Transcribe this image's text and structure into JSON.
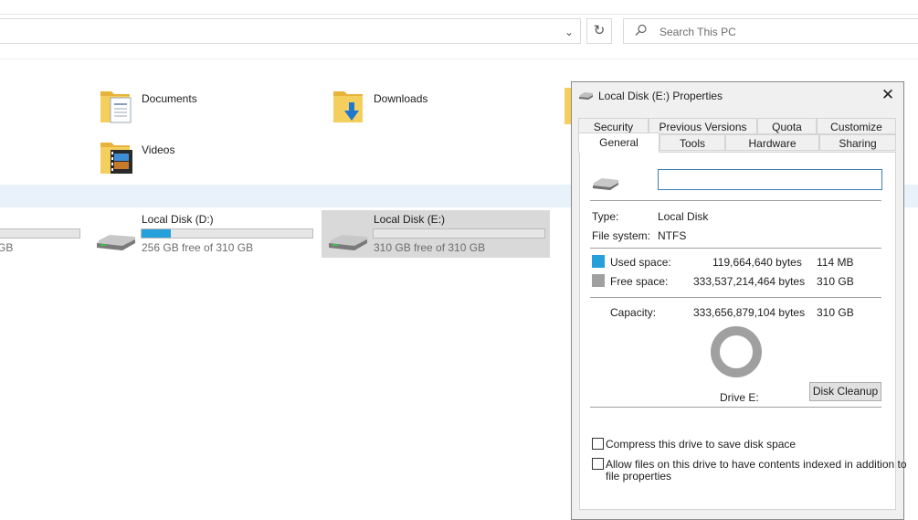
{
  "explorer": {
    "search_placeholder": "Search This PC",
    "folders": [
      {
        "label": "Documents"
      },
      {
        "label": "Downloads"
      },
      {
        "label": "Videos"
      }
    ],
    "drives": [
      {
        "name": "",
        "free_text": "GB",
        "used_fraction": 0.0
      },
      {
        "name": "Local Disk (D:)",
        "free_text": "256 GB free of 310 GB",
        "used_fraction": 0.17
      },
      {
        "name": "Local Disk (E:)",
        "free_text": "310 GB free of 310 GB",
        "used_fraction": 0.0
      }
    ]
  },
  "dialog": {
    "title": "Local Disk (E:) Properties",
    "tabs_row1": [
      "Security",
      "Previous Versions",
      "Quota",
      "Customize"
    ],
    "tabs_row2": [
      "General",
      "Tools",
      "Hardware",
      "Sharing"
    ],
    "active_tab": "General",
    "name_value": "",
    "type_label": "Type:",
    "type_value": "Local Disk",
    "fs_label": "File system:",
    "fs_value": "NTFS",
    "used_label": "Used space:",
    "used_bytes": "119,664,640 bytes",
    "used_size": "114 MB",
    "free_label": "Free space:",
    "free_bytes": "333,537,214,464 bytes",
    "free_size": "310 GB",
    "capacity_label": "Capacity:",
    "capacity_bytes": "333,656,879,104 bytes",
    "capacity_size": "310 GB",
    "drive_label": "Drive E:",
    "cleanup_label": "Disk Cleanup",
    "compress_label": "Compress this drive to save disk space",
    "index_label_line1": "Allow files on this drive to have contents indexed in addition to",
    "index_label_line2": "file properties",
    "colors": {
      "used": "#26a0da",
      "free": "#a0a0a0"
    }
  }
}
